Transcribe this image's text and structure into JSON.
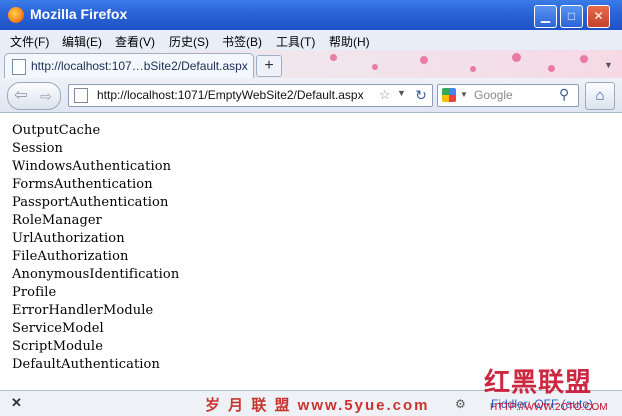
{
  "window": {
    "title": "Mozilla Firefox"
  },
  "menu": [
    "文件(F)",
    "编辑(E)",
    "查看(V)",
    "历史(S)",
    "书签(B)",
    "工具(T)",
    "帮助(H)"
  ],
  "tab": {
    "title": "http://localhost:107…bSite2/Default.aspx",
    "new_tab": "+"
  },
  "nav": {
    "url": "http://localhost:1071/EmptyWebSite2/Default.aspx",
    "search_placeholder": "Google"
  },
  "content_lines": [
    "OutputCache",
    "Session",
    "WindowsAuthentication",
    "FormsAuthentication",
    "PassportAuthentication",
    "RoleManager",
    "UrlAuthorization",
    "FileAuthorization",
    "AnonymousIdentification",
    "Profile",
    "ErrorHandlerModule",
    "ServiceModel",
    "ScriptModule",
    "DefaultAuthentication"
  ],
  "status": {
    "fiddler": "Fiddler: OFF (auto)",
    "watermark_center": "岁 月 联 盟   www.5yue.com",
    "watermark_right": "红黑联盟",
    "watermark_url": "HTTP://WWW.2CTO.COM"
  },
  "colors": {
    "titlebar": "#2a63d6",
    "watermark": "#c8112e",
    "link": "#2a62c0"
  }
}
